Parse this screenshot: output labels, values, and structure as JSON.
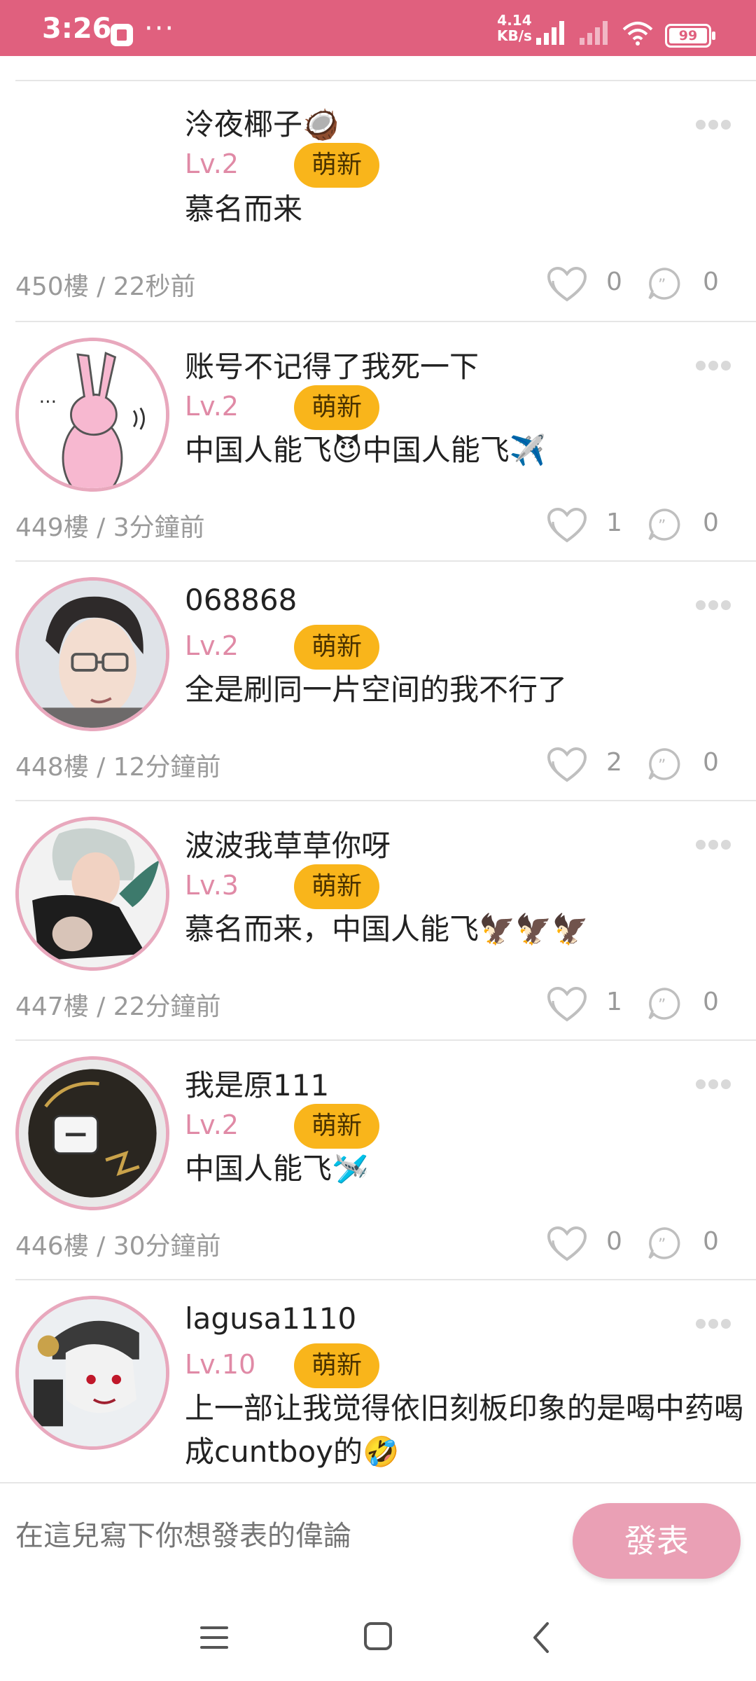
{
  "status_bar": {
    "time": "3:26",
    "dots": "···",
    "network_speed_value": "4.14",
    "network_speed_unit": "KB/s",
    "battery": "99"
  },
  "comments": [
    {
      "username": "泠夜椰子🥥",
      "level": "Lv.2",
      "badge": "萌新",
      "content": "慕名而来",
      "floor": "450樓 / 22秒前",
      "likes": "0",
      "replies": "0"
    },
    {
      "username": "账号不记得了我死一下",
      "level": "Lv.2",
      "badge": "萌新",
      "content": "中国人能飞😈中国人能飞✈️",
      "floor": "449樓 / 3分鐘前",
      "likes": "1",
      "replies": "0"
    },
    {
      "username": "068868",
      "level": "Lv.2",
      "badge": "萌新",
      "content": "全是刷同一片空间的我不行了",
      "floor": "448樓 / 12分鐘前",
      "likes": "2",
      "replies": "0"
    },
    {
      "username": "波波我草草你呀",
      "level": "Lv.3",
      "badge": "萌新",
      "content": "慕名而来，中国人能飞🦅🦅🦅",
      "floor": "447樓 / 22分鐘前",
      "likes": "1",
      "replies": "0"
    },
    {
      "username": "我是原111",
      "level": "Lv.2",
      "badge": "萌新",
      "content": "中国人能飞🛩️",
      "floor": "446樓 / 30分鐘前",
      "likes": "0",
      "replies": "0"
    },
    {
      "username": "lagusa1110",
      "level": "Lv.10",
      "badge": "萌新",
      "content": "上一部让我觉得依旧刻板印象的是喝中药喝成cuntboy的🤣"
    }
  ],
  "input": {
    "placeholder": "在這兒寫下你想發表的偉論",
    "post_label": "發表"
  },
  "colors": {
    "status_bar": "#e0607e",
    "level": "#e08aa6",
    "badge": "#f9b51b",
    "avatar_border": "#e8a8bd",
    "post_button": "#eaa0b5"
  }
}
